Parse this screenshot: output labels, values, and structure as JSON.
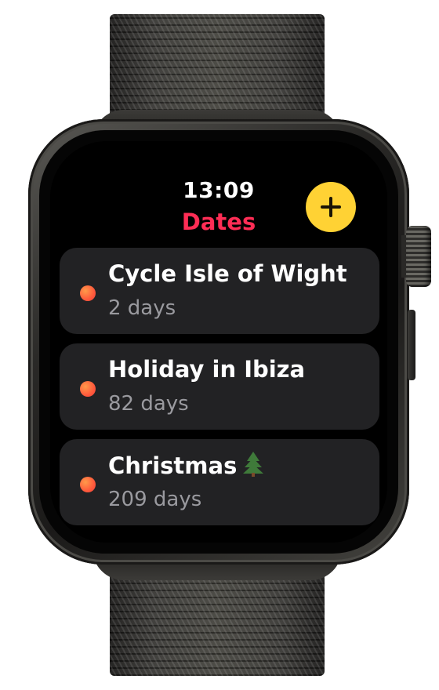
{
  "status": {
    "time": "13:09"
  },
  "header": {
    "title": "Dates"
  },
  "toolbar": {
    "add_icon": "plus-icon"
  },
  "events": [
    {
      "title": "Cycle Isle of Wight",
      "subtitle": "2 days",
      "emoji": ""
    },
    {
      "title": "Holiday in Ibiza",
      "subtitle": "82 days",
      "emoji": ""
    },
    {
      "title": "Christmas",
      "subtitle": "209 days",
      "emoji": "christmas-tree-icon"
    }
  ],
  "colors": {
    "accent_title": "#ff2d55",
    "add_button": "#ffd234",
    "event_dot": "#ff5a3c",
    "row_background": "#222224"
  }
}
